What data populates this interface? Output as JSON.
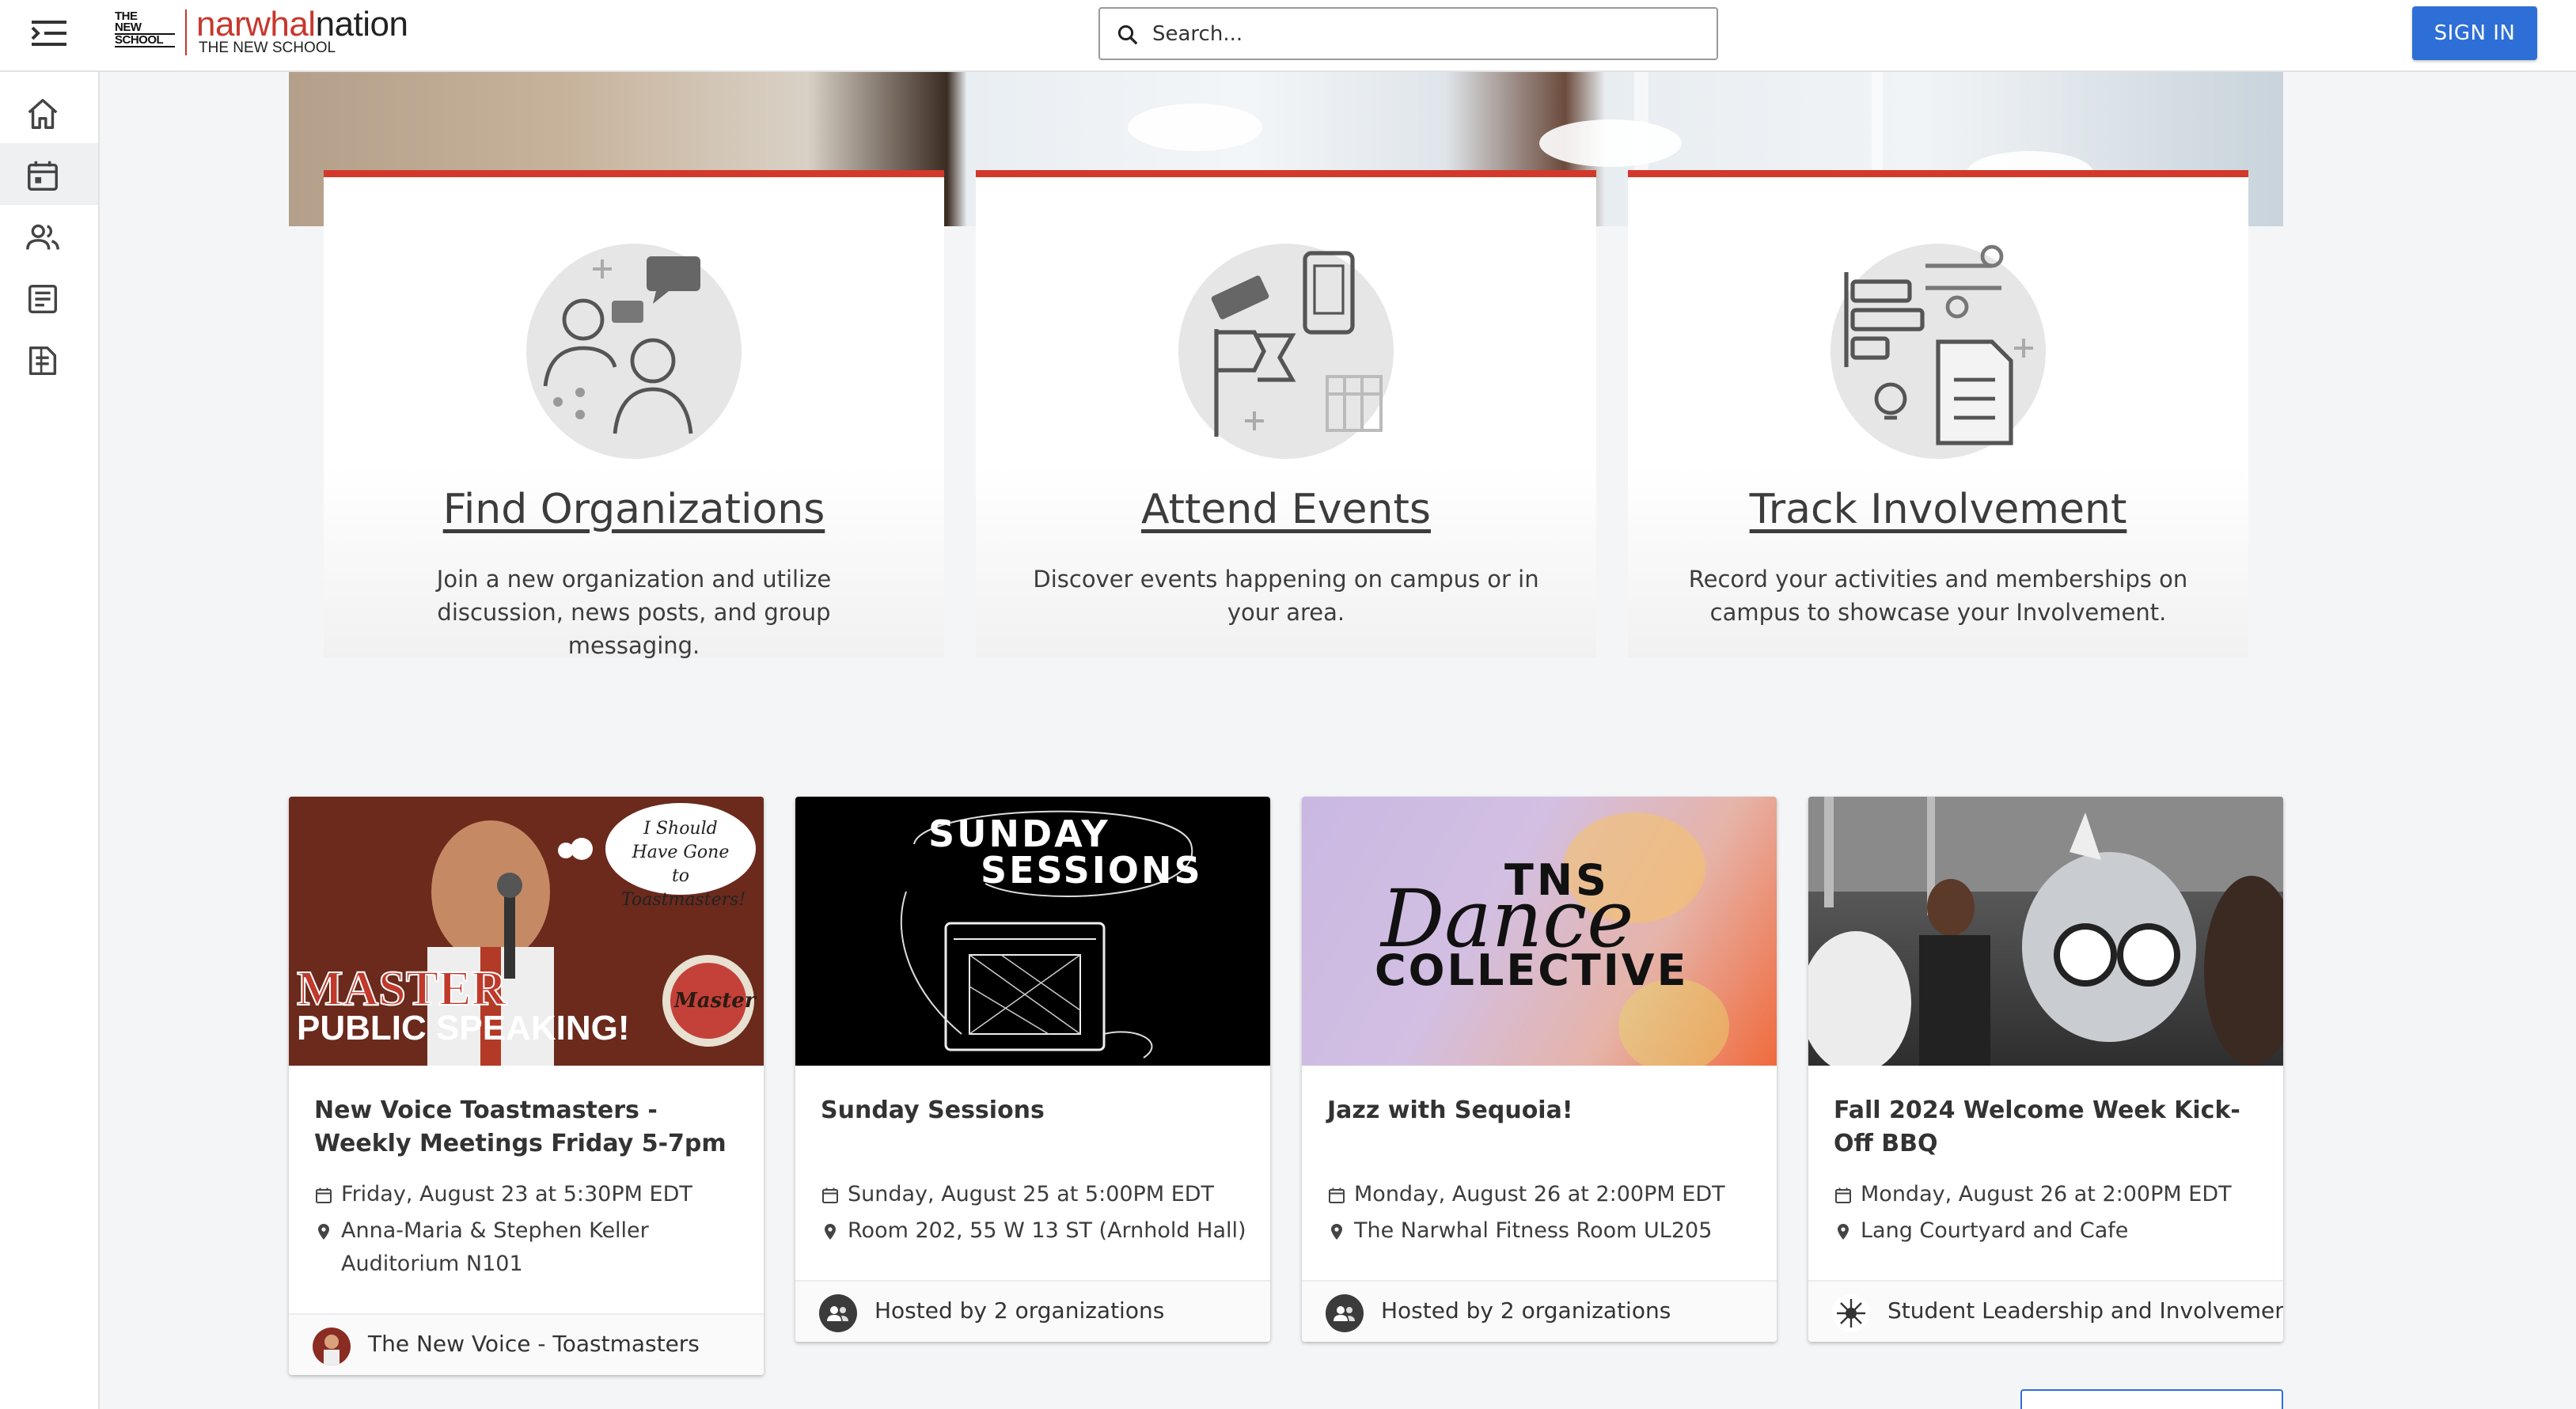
{
  "header": {
    "logo_line1": "THE",
    "logo_line2": "NEW",
    "logo_line3": "SCHOOL",
    "brand_first": "narwhal",
    "brand_second": "nation",
    "brand_sub": "THE NEW SCHOOL",
    "search_placeholder": "Search...",
    "signin_label": "SIGN IN"
  },
  "sidebar": {
    "items": [
      {
        "name": "home",
        "icon": "home-icon"
      },
      {
        "name": "events",
        "icon": "calendar-icon",
        "active": true
      },
      {
        "name": "organizations",
        "icon": "people-icon"
      },
      {
        "name": "news",
        "icon": "news-icon"
      },
      {
        "name": "forms",
        "icon": "forms-icon"
      }
    ]
  },
  "features": [
    {
      "title": "Find Organizations",
      "description": "Join a new organization and utilize discussion, news posts, and group messaging."
    },
    {
      "title": "Attend Events",
      "description": "Discover events happening on campus or in your area."
    },
    {
      "title": "Track Involvement",
      "description": "Record your activities and memberships on campus to showcase your Involvement."
    }
  ],
  "events": [
    {
      "title": "New Voice Toastmasters - Weekly Meetings Friday 5-7pm",
      "date": "Friday, August 23 at 5:30PM EDT",
      "location": "Anna-Maria & Stephen Keller Auditorium N101",
      "host": "The New Voice - Toastmasters",
      "image_text": {
        "bubble": "I Should Have Gone to Toastmasters!",
        "line1": "MASTER",
        "line2": "PUBLIC SPEAKING!",
        "badge": "Master"
      }
    },
    {
      "title": "Sunday Sessions",
      "date": "Sunday, August 25 at 5:00PM EDT",
      "location": "Room 202, 55 W 13 ST (Arnhold Hall)",
      "host": "Hosted by 2 organizations",
      "image_text": {
        "line1": "SUNDAY",
        "line2": "SESSIONS"
      }
    },
    {
      "title": "Jazz with Sequoia!",
      "date": "Monday, August 26 at 2:00PM EDT",
      "location": "The Narwhal Fitness Room UL205",
      "host": "Hosted by 2 organizations",
      "image_text": {
        "line1": "TNS",
        "line2": "Dance",
        "line3": "COLLECTIVE"
      }
    },
    {
      "title": "Fall 2024 Welcome Week Kick-Off BBQ",
      "date": "Monday, August 26 at 2:00PM EDT",
      "location": "Lang Courtyard and Cafe",
      "host": "Student Leadership and Involvement"
    }
  ],
  "colors": {
    "accent": "#d2392c",
    "primary": "#2d6fd6",
    "brand_red": "#c8372d"
  }
}
